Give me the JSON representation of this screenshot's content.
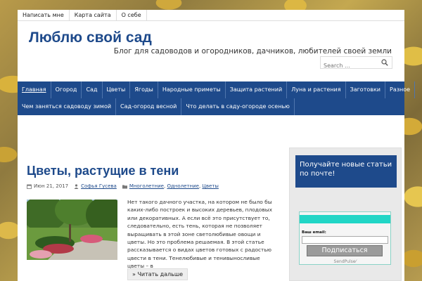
{
  "topbar": {
    "links": [
      "Написать мне",
      "Карта сайта",
      "О себе"
    ]
  },
  "site": {
    "title": "Люблю свой сад",
    "description": "Блог для садоводов и огородников, дачников, любителей своей земли"
  },
  "search": {
    "placeholder": "Search ..."
  },
  "nav": {
    "row1": [
      "Главная",
      "Огород",
      "Сад",
      "Цветы",
      "Ягоды",
      "Народные приметы",
      "Защита растений",
      "Луна и растения",
      "Заготовки",
      "Разное"
    ],
    "row2": [
      "Чем заняться садоводу зимой",
      "Сад-огород весной",
      "Что делать в саду-огороде осенью"
    ],
    "active": "Главная"
  },
  "post": {
    "title": "Цветы, растущие в тени",
    "date": "Июн 21, 2017",
    "author": "Софья Гусева",
    "categories": [
      "Многолетние",
      "Однолетние",
      "Цветы"
    ],
    "category_separator": ",",
    "excerpt": "Нет такого дачного участка, на котором не было бы каких-либо построек и высоких деревьев, плодовых или декоративных. А если всё это присутствует то, следовательно, есть тень, которая не позволяет выращивать в этой зоне светолюбивые овощи и цветы. Но это проблема решаемая. В этой статье рассказывается о видах цветов готовых с радостью цвести в тени. Тенелюбивые и тенивыносливые цветы – в",
    "read_more": "» Читать дальше"
  },
  "widget": {
    "title": "Получайте новые статьи по почте!",
    "email_label": "Ваш email:",
    "subscribe_label": "Подписаться",
    "powered_by": "SendPulse⁄"
  },
  "colors": {
    "brand_blue": "#1e4a8b",
    "teal": "#22d6c6"
  }
}
